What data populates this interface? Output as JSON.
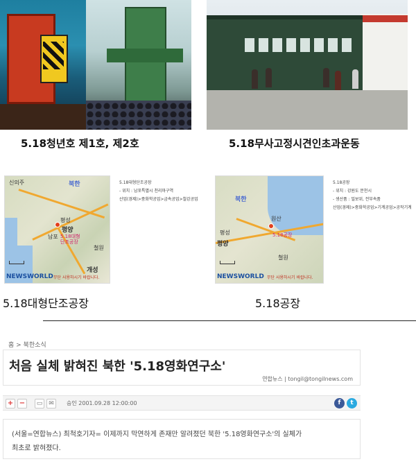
{
  "photos": [
    {
      "name": "youth-press-1"
    },
    {
      "name": "youth-press-2"
    },
    {
      "name": "train-platform"
    }
  ],
  "captions": {
    "press": "5.18청년호 제1호, 제2호",
    "movement": "5.18무사고정시견인초과운동",
    "forging": "5.18대형단조공장",
    "factory": "5.18공장"
  },
  "map1": {
    "info_title": "5.18대형단조공장",
    "info_lines": [
      "- 위치 : 남포특별시 천리마구역",
      "산업(경제)>중화학공업>금속공업>철강공업"
    ],
    "labels": [
      "신의주",
      "북한",
      "평성",
      "평양",
      "남포",
      "5.18대형",
      "단조공장",
      "철원",
      "개성"
    ],
    "logo_main": "NEWSWORLD",
    "credit": "무단 사용하시기 바랍니다."
  },
  "map2": {
    "info_title": "5.18공장",
    "info_lines": [
      "- 위치 : 강원도 문천시",
      "- 생산품 : 밀보위, 전부속품",
      "산업(경제)>중화학공업>기계공업>공작기계"
    ],
    "labels": [
      "북한",
      "평성",
      "원산",
      "5.18공장",
      "평양",
      "철원"
    ],
    "logo_main": "NEWSWORLD",
    "credit": "무단 사용하시기 바랍니다."
  },
  "article": {
    "breadcrumb": "홈 > 북한소식",
    "title": "처음 실체 밝혀진 북한 '5.18영화연구소'",
    "source": "연합뉴스  |  tongil@tongilnews.com",
    "date": "승인 2001.09.28  12:00:00",
    "toolbar": {
      "plus": "+",
      "minus": "−"
    },
    "social": {
      "facebook": "f",
      "twitter": "t"
    },
    "body": [
      "(서울=연합뉴스) 최척호기자= 이제까지 막연하게 존재만 알려졌던 북한 '5.18영화연구소'의 실체가",
      "최초로 밝혀졌다."
    ]
  },
  "colors": {
    "divider": "#222222",
    "facebook": "#3b5998",
    "twitter": "#2aa9e0",
    "pin": "#e2401c"
  }
}
